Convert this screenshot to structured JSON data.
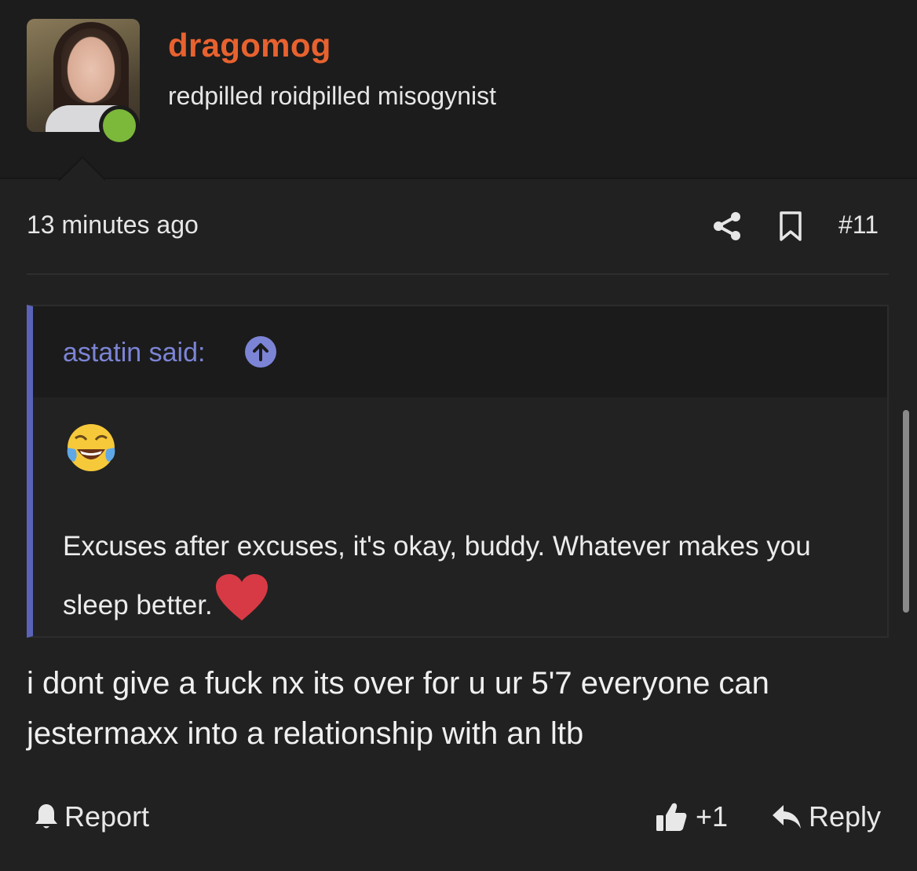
{
  "author": {
    "username": "dragomog",
    "user_title": "redpilled roidpilled misogynist",
    "online_status_color": "#7cb83a",
    "username_color": "#e8622f"
  },
  "post": {
    "time": "13 minutes ago",
    "number": "#11",
    "quote": {
      "author_label": "astatin said:",
      "emoji": "face-with-tears-of-joy",
      "text": "Excuses after excuses, it's okay, buddy. Whatever makes you sleep better.",
      "heart": "red-heart",
      "accent_color": "#5b63b8"
    },
    "message": "i dont give a fuck nx its over for u ur 5'7 everyone can jestermaxx into a relationship with an ltb"
  },
  "actions": {
    "report_label": "Report",
    "like_count": "+1",
    "reply_label": "Reply"
  },
  "icons": {
    "share": "share-icon",
    "bookmark": "bookmark-icon",
    "quote_jump": "arrow-up-circle-icon",
    "report": "bell-icon",
    "like": "thumbs-up-icon",
    "reply": "reply-arrow-icon"
  }
}
